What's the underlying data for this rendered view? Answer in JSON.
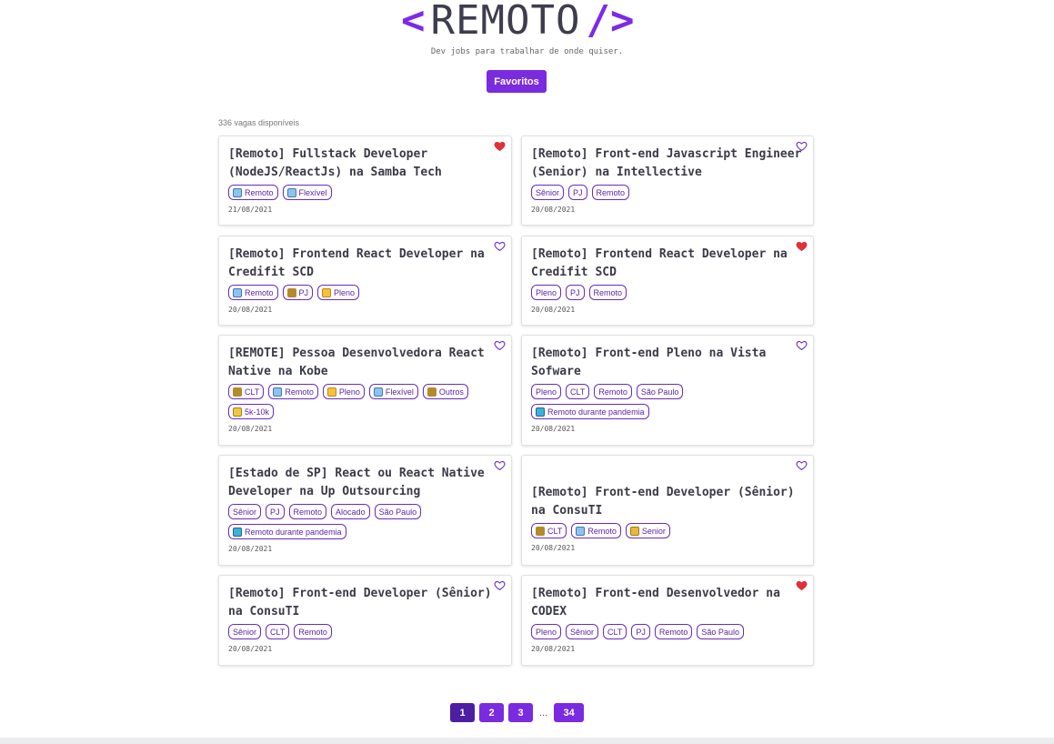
{
  "header": {
    "logo_left": "<",
    "logo_word": "REMOTO",
    "logo_right": "/>",
    "subtitle": "Dev jobs para trabalhar de onde quiser.",
    "favorites_label": "Favoritos"
  },
  "listing": {
    "count_text": "336 vagas disponíveis"
  },
  "jobs": [
    {
      "title": "[Remoto] Fullstack Developer (NodeJS/ReactJs) na Samba Tech",
      "favorited": true,
      "tags": [
        {
          "icon": "building",
          "label": "Remoto"
        },
        {
          "icon": "building",
          "label": "Flexível"
        }
      ],
      "date": "21/08/2021"
    },
    {
      "title": "[Remoto] Front-end Javascript Engineer (Senior) na Intellective",
      "favorited": false,
      "tags": [
        {
          "icon": "",
          "label": "Sênior"
        },
        {
          "icon": "",
          "label": "PJ"
        },
        {
          "icon": "",
          "label": "Remoto"
        }
      ],
      "date": "20/08/2021"
    },
    {
      "title": "[Remoto] Frontend React Developer na Credifit SCD",
      "favorited": false,
      "tags": [
        {
          "icon": "building",
          "label": "Remoto"
        },
        {
          "icon": "handshake",
          "label": "PJ"
        },
        {
          "icon": "smile",
          "label": "Pleno"
        }
      ],
      "date": "20/08/2021"
    },
    {
      "title": "[Remoto] Frontend React Developer na Credifit SCD",
      "favorited": true,
      "tags": [
        {
          "icon": "",
          "label": "Pleno"
        },
        {
          "icon": "",
          "label": "PJ"
        },
        {
          "icon": "",
          "label": "Remoto"
        }
      ],
      "date": "20/08/2021"
    },
    {
      "title": "[REMOTE] Pessoa Desenvolvedora React Native na Kobe",
      "favorited": false,
      "tags": [
        {
          "icon": "handshake",
          "label": "CLT"
        },
        {
          "icon": "building",
          "label": "Remoto"
        },
        {
          "icon": "smile",
          "label": "Pleno"
        },
        {
          "icon": "building",
          "label": "Flexível"
        },
        {
          "icon": "handshake",
          "label": "Outros"
        },
        {
          "icon": "money",
          "label": "5k-10k"
        }
      ],
      "date": "20/08/2021"
    },
    {
      "title": "[Remoto] Front-end Pleno na Vista Sofware",
      "favorited": false,
      "tags": [
        {
          "icon": "",
          "label": "Pleno"
        },
        {
          "icon": "",
          "label": "CLT"
        },
        {
          "icon": "",
          "label": "Remoto"
        },
        {
          "icon": "",
          "label": "São Paulo"
        },
        {
          "icon": "pill",
          "label": "Remoto durante pandemia"
        }
      ],
      "date": "20/08/2021"
    },
    {
      "title": "[Estado de SP] React ou React Native Developer na Up Outsourcing",
      "favorited": false,
      "tags": [
        {
          "icon": "",
          "label": "Sênior"
        },
        {
          "icon": "",
          "label": "PJ"
        },
        {
          "icon": "",
          "label": "Remoto"
        },
        {
          "icon": "",
          "label": "Alocado"
        },
        {
          "icon": "",
          "label": "São Paulo"
        },
        {
          "icon": "pill",
          "label": "Remoto durante pandemia"
        }
      ],
      "date": "20/08/2021"
    },
    {
      "title": "[Remoto] Front-end Developer (Sênior) na ConsuTI",
      "favorited": false,
      "tags": [
        {
          "icon": "handshake",
          "label": "CLT"
        },
        {
          "icon": "building",
          "label": "Remoto"
        },
        {
          "icon": "shield",
          "label": "Senior"
        }
      ],
      "date": "20/08/2021"
    },
    {
      "title": "[Remoto] Front-end Developer (Sênior) na ConsuTI",
      "favorited": false,
      "tags": [
        {
          "icon": "",
          "label": "Sênior"
        },
        {
          "icon": "",
          "label": "CLT"
        },
        {
          "icon": "",
          "label": "Remoto"
        }
      ],
      "date": "20/08/2021"
    },
    {
      "title": "[Remoto] Front-end Desenvolvedor na CODEX",
      "favorited": true,
      "tags": [
        {
          "icon": "",
          "label": "Pleno"
        },
        {
          "icon": "",
          "label": "Sênior"
        },
        {
          "icon": "",
          "label": "CLT"
        },
        {
          "icon": "",
          "label": "PJ"
        },
        {
          "icon": "",
          "label": "Remoto"
        },
        {
          "icon": "",
          "label": "São Paulo"
        }
      ],
      "date": "20/08/2021"
    }
  ],
  "pagination": {
    "pages": [
      "1",
      "2",
      "3"
    ],
    "ellipsis": "...",
    "last": "34",
    "current": "1"
  },
  "colors": {
    "accent": "#7a2be0",
    "heart_filled": "#e0303a",
    "heart_outline": "#6b2bbd"
  }
}
